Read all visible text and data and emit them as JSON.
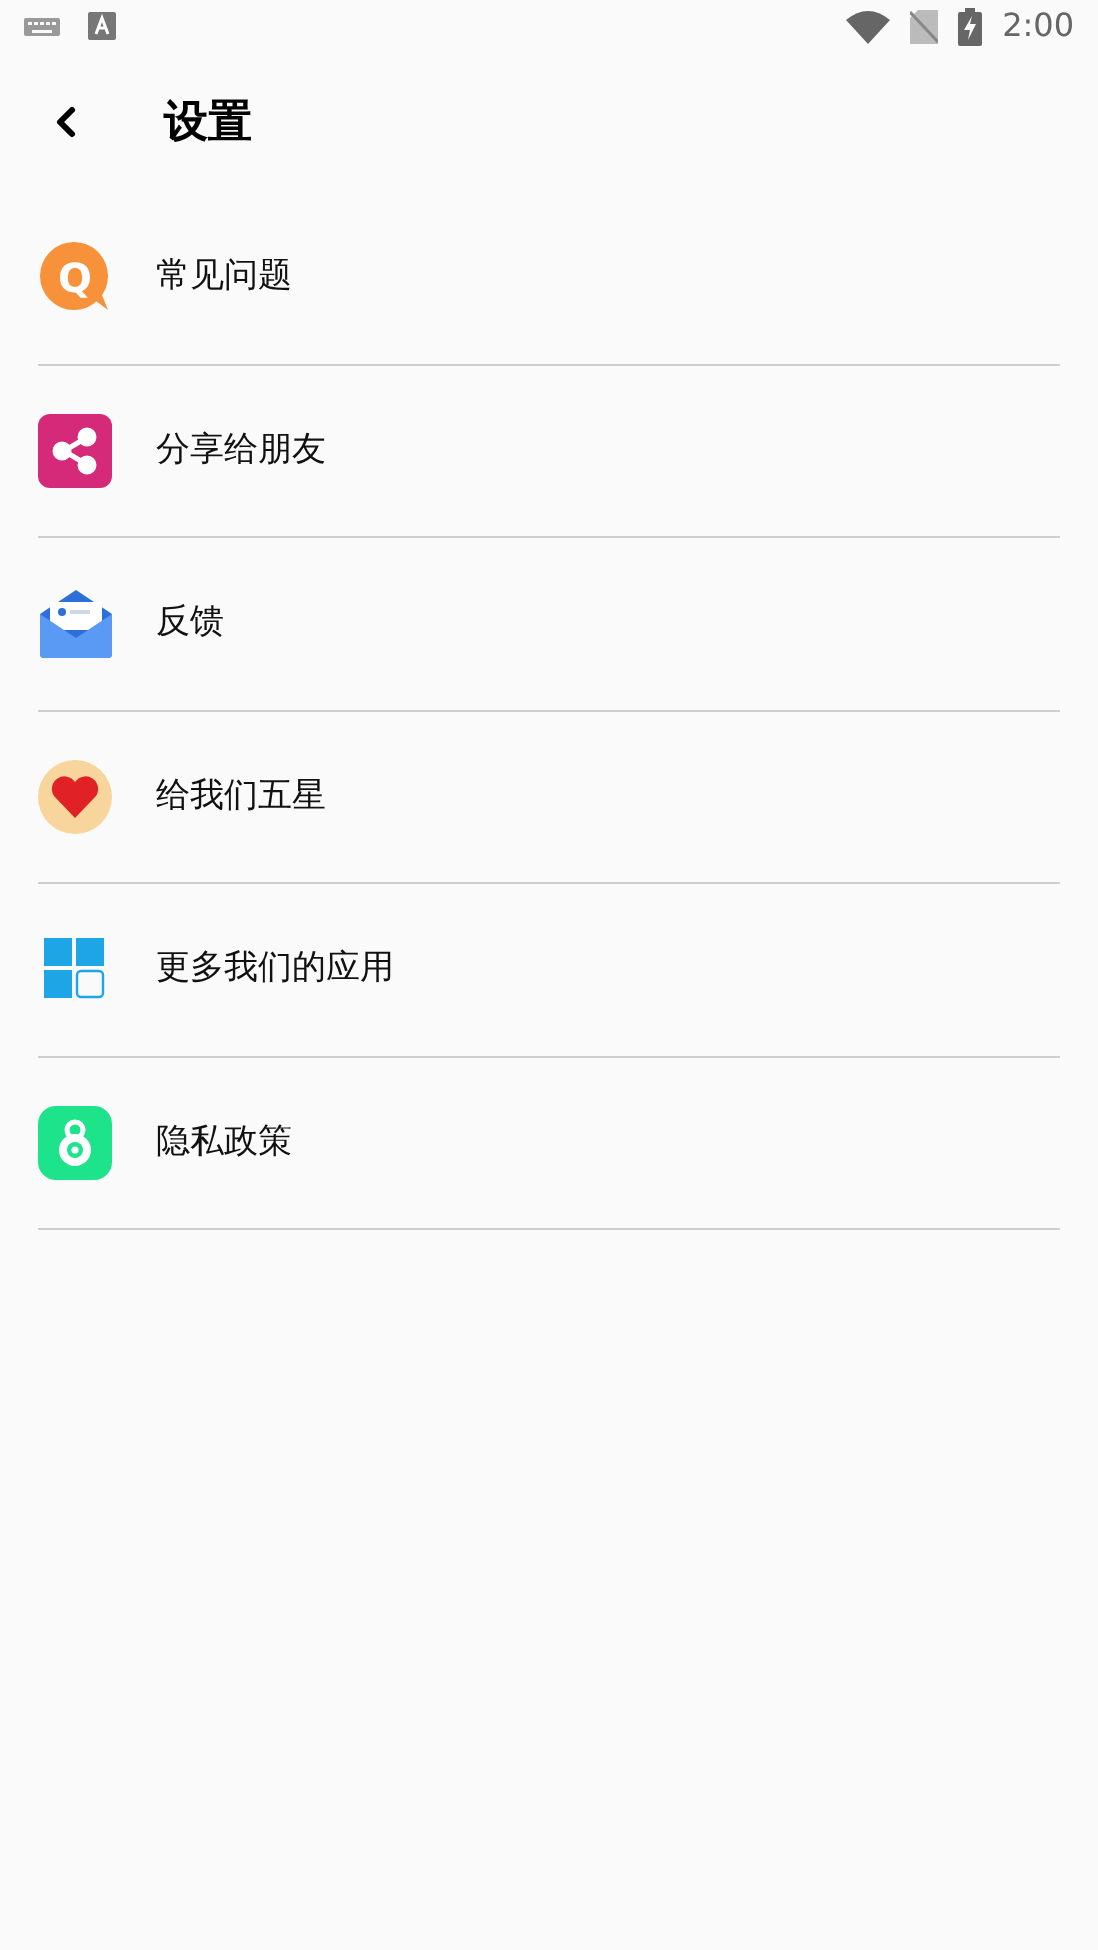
{
  "status_bar": {
    "time": "2:00"
  },
  "header": {
    "title": "设置"
  },
  "items": [
    {
      "kind": "faq",
      "label": "常见问题",
      "icon_text": "Q"
    },
    {
      "kind": "share",
      "label": "分享给朋友"
    },
    {
      "kind": "feedback",
      "label": "反馈"
    },
    {
      "kind": "rate",
      "label": "给我们五星"
    },
    {
      "kind": "apps",
      "label": "更多我们的应用"
    },
    {
      "kind": "privacy",
      "label": "隐私政策"
    }
  ]
}
